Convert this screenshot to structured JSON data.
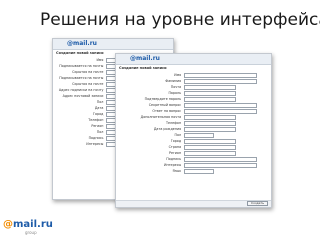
{
  "slide": {
    "title": "Решения на уровне интерфейса"
  },
  "brand": {
    "logo_at": "@",
    "logo_text": "mail.ru",
    "logo_sub": "group"
  },
  "colors": {
    "brand_blue": "#1d5ba8",
    "brand_orange": "#f28c00",
    "frame_header": "#e9eef4"
  },
  "back_form": {
    "logo": "@mail.ru",
    "caption": "Создание новой записи",
    "rows": [
      {
        "label": "Имя",
        "field": "w-m"
      },
      {
        "label": "Подписывается на почты",
        "field": "w-l"
      },
      {
        "label": "Скрытая на почте",
        "field": "w-m"
      },
      {
        "label": "Подписывается на почты",
        "field": "w-m"
      },
      {
        "label": "Скрытая на почте",
        "field": "w-m"
      },
      {
        "label": "Адрес подписки на почту",
        "field": "w-l"
      },
      {
        "label": "Адрес почтовой записи",
        "field": "w-m"
      },
      {
        "label": "Пол",
        "field": "w-s"
      },
      {
        "label": "Дата",
        "field": "w-m"
      },
      {
        "label": "Город",
        "field": "w-m"
      },
      {
        "label": "Телефон",
        "field": "w-s"
      },
      {
        "label": "Регион",
        "field": "w-s"
      },
      {
        "label": "Пол",
        "field": "w-s"
      },
      {
        "label": "Подпись",
        "field": "w-m"
      },
      {
        "label": "Интересы",
        "field": "w-l"
      }
    ]
  },
  "front_form": {
    "logo": "@mail.ru",
    "caption": "Создание новой записи",
    "rows": [
      {
        "label": "Имя",
        "field": "w-l"
      },
      {
        "label": "Фамилия",
        "field": "w-l"
      },
      {
        "label": "Почта",
        "field": "w-m"
      },
      {
        "label": "Пароль",
        "field": "w-m"
      },
      {
        "label": "Подтвердите пароль",
        "field": "w-m"
      },
      {
        "label": "Секретный вопрос",
        "field": "w-l"
      },
      {
        "label": "Ответ на вопрос",
        "field": "w-l"
      },
      {
        "label": "Дополнительная почта",
        "field": "w-m"
      },
      {
        "label": "Телефон",
        "field": "w-m"
      },
      {
        "label": "Дата рождения",
        "field": "w-m"
      },
      {
        "label": "Пол",
        "field": "w-s"
      },
      {
        "label": "Город",
        "field": "w-m"
      },
      {
        "label": "Страна",
        "field": "w-m"
      },
      {
        "label": "Регион",
        "field": "w-m"
      },
      {
        "label": "Подпись",
        "field": "w-l"
      },
      {
        "label": "Интересы",
        "field": "w-l"
      },
      {
        "label": "Язык",
        "field": "w-s"
      }
    ],
    "submit_label": "Создать"
  }
}
